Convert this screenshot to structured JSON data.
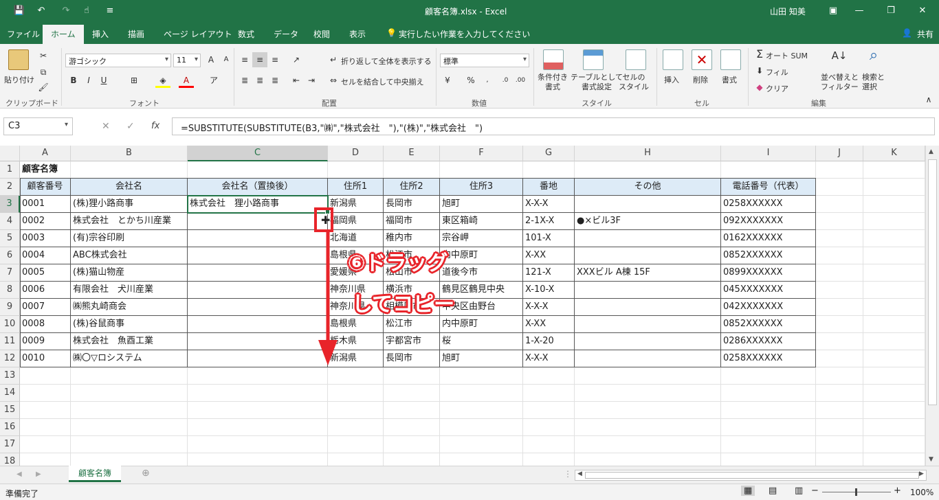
{
  "window": {
    "title": "顧客名簿.xlsx  -  Excel",
    "user": "山田 知美",
    "share": "共有"
  },
  "tabs": [
    "ファイル",
    "ホーム",
    "挿入",
    "描画",
    "ページ レイアウト",
    "数式",
    "データ",
    "校閲",
    "表示"
  ],
  "tell_me": "実行したい作業を入力してください",
  "ribbon": {
    "paste": "貼り付け",
    "font_name": "游ゴシック",
    "font_size": "11",
    "wrap_text": "折り返して全体を表示する",
    "merge_center": "セルを結合して中央揃え",
    "number_format": "標準",
    "cond_format": "条件付き\n書式",
    "table_format": "テーブルとして\n書式設定",
    "cell_style": "セルの\nスタイル",
    "insert": "挿入",
    "delete": "削除",
    "format": "書式",
    "autosum": "オート SUM",
    "fill": "フィル",
    "clear": "クリア",
    "sort_filter": "並べ替えと\nフィルター",
    "find_select": "検索と\n選択",
    "groups": [
      "クリップボード",
      "フォント",
      "配置",
      "数値",
      "スタイル",
      "セル",
      "編集"
    ]
  },
  "formula_bar": {
    "name_box": "C3",
    "formula": "=SUBSTITUTE(SUBSTITUTE(B3,\"㈱\",\"株式会社　\"),\"(株)\",\"株式会社　\")"
  },
  "columns": [
    "A",
    "B",
    "C",
    "D",
    "E",
    "F",
    "G",
    "H",
    "I",
    "J",
    "K"
  ],
  "rows": [
    "1",
    "2",
    "3",
    "4",
    "5",
    "6",
    "7",
    "8",
    "9",
    "10",
    "11",
    "12",
    "13",
    "14",
    "15",
    "16",
    "17",
    "18"
  ],
  "table": {
    "title": "顧客名簿",
    "headers": [
      "顧客番号",
      "会社名",
      "会社名（置換後）",
      "住所1",
      "住所2",
      "住所3",
      "番地",
      "その他",
      "電話番号（代表）"
    ],
    "rows": [
      [
        "0001",
        "(株)狸小路商事",
        "株式会社　狸小路商事",
        "新潟県",
        "長岡市",
        "旭町",
        "X-X-X",
        "",
        "0258XXXXXX"
      ],
      [
        "0002",
        "株式会社　とかち川産業",
        "",
        "福岡県",
        "福岡市",
        "東区箱崎",
        "2-1X-X",
        "●×ビル3F",
        "092XXXXXXX"
      ],
      [
        "0003",
        "(有)宗谷印刷",
        "",
        "北海道",
        "稚内市",
        "宗谷岬",
        "101-X",
        "",
        "0162XXXXXX"
      ],
      [
        "0004",
        "ABC株式会社",
        "",
        "島根県",
        "松江市",
        "内中原町",
        "X-XX",
        "",
        "0852XXXXXX"
      ],
      [
        "0005",
        "(株)猫山物産",
        "",
        "愛媛県",
        "松山市",
        "道後今市",
        "121-X",
        "XXXビル A棟 15F",
        "0899XXXXXX"
      ],
      [
        "0006",
        "有限会社　犬川産業",
        "",
        "神奈川県",
        "横浜市",
        "鶴見区鶴見中央",
        "X-10-X",
        "",
        "045XXXXXXX"
      ],
      [
        "0007",
        "㈱熊丸崎商会",
        "",
        "神奈川県",
        "相模原市",
        "中央区由野台",
        "X-X-X",
        "",
        "042XXXXXXX"
      ],
      [
        "0008",
        "(株)谷鼠商事",
        "",
        "島根県",
        "松江市",
        "内中原町",
        "X-XX",
        "",
        "0852XXXXXX"
      ],
      [
        "0009",
        "株式会社　魚酉工業",
        "",
        "栃木県",
        "宇都宮市",
        "桜",
        "1-X-20",
        "",
        "0286XXXXXX"
      ],
      [
        "0010",
        "㈱〇▽ロシステム",
        "",
        "新潟県",
        "長岡市",
        "旭町",
        "X-X-X",
        "",
        "0258XXXXXX"
      ]
    ]
  },
  "annotation": {
    "line1": "⑥ドラッグ",
    "line2": "してコピー",
    "color": "#e8242a"
  },
  "sheet_tab": "顧客名簿",
  "status": {
    "ready": "準備完了",
    "zoom": "100%"
  }
}
